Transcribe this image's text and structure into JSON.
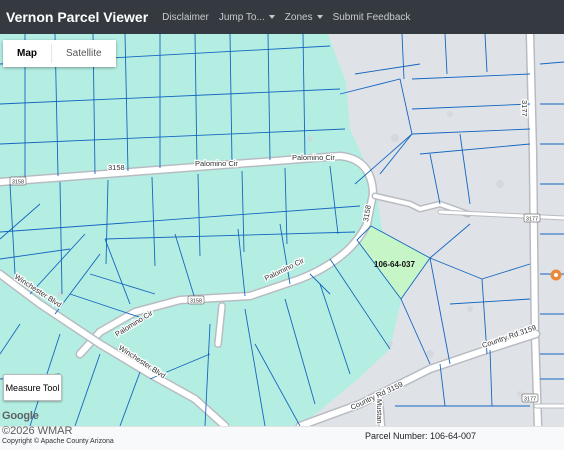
{
  "navbar": {
    "brand": "Vernon Parcel Viewer",
    "items": [
      {
        "label": "Disclaimer",
        "dropdown": false
      },
      {
        "label": "Jump To...",
        "dropdown": true
      },
      {
        "label": "Zones",
        "dropdown": true
      },
      {
        "label": "Submit Feedback",
        "dropdown": false
      }
    ]
  },
  "map": {
    "map_types": [
      "Map",
      "Satellite"
    ],
    "selected_map_type": "Map",
    "road_labels": {
      "palomino_1": "Palomino Cir",
      "palomino_2": "Palomino Cir",
      "palomino_3": "Palomino Cir",
      "palomino_4": "Palomino Cir",
      "winchester_1": "Winchester Blvd",
      "winchester_2": "Winchester Blvd",
      "country_rd_1": "Country Rd 3159",
      "country_rd_2": "Country Rd 3159",
      "mustang": "Mustan",
      "rd_3158": "3158",
      "rd_3177": "3177"
    },
    "road_shields": {
      "shield_3158": "3158",
      "shield_3158b": "3158",
      "shield_3177": "3177",
      "shield_3177b": "3177"
    },
    "parcel_label": "106-64-037",
    "measure_tool": "Measure Tool",
    "google_logo": "Google",
    "colors": {
      "zone_fill": "#b4eee2",
      "selected_fill": "#c6f6c8",
      "parcel_line": "#1566c0",
      "road": "#ffffff",
      "road_edge": "#b8bcc2",
      "base": "#dfe3e8"
    }
  },
  "footer": {
    "copyright": "Copyright © Apache County Arizona",
    "parcel_number": "Parcel Number: 106-64-007",
    "watermark": "©2026 WMAR"
  }
}
